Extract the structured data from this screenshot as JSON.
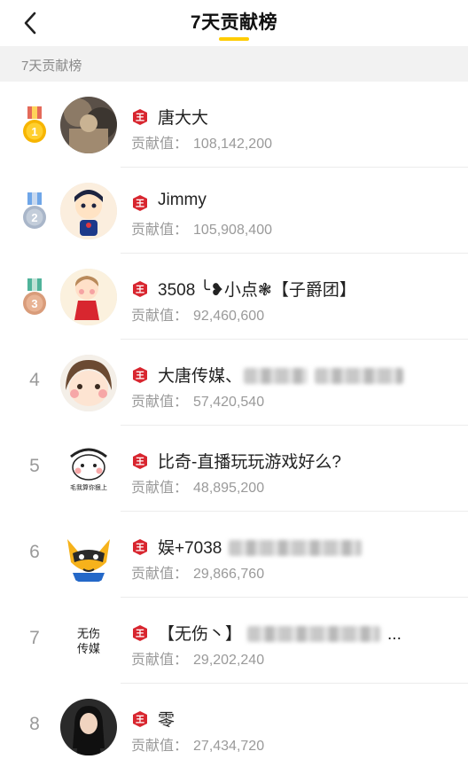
{
  "header": {
    "title": "7天贡献榜"
  },
  "section": {
    "label": "7天贡献榜"
  },
  "contrib_label": "贡献值：",
  "colors": {
    "accent": "#ffcc00",
    "badge": "#d8262f",
    "gold": "#f7b500",
    "silver": "#a9b6c9",
    "bronze": "#d99c7a"
  },
  "rows": [
    {
      "rank": "1",
      "name": "唐大大",
      "value": "108,142,200"
    },
    {
      "rank": "2",
      "name": "Jimmy",
      "value": "105,908,400"
    },
    {
      "rank": "3",
      "name": "3508 ╰❥小点❃【子爵团】",
      "value": "92,460,600"
    },
    {
      "rank": "4",
      "name": "大唐传媒、",
      "value": "57,420,540"
    },
    {
      "rank": "5",
      "name": "比奇-直播玩玩游戏好么?",
      "value": "48,895,200"
    },
    {
      "rank": "6",
      "name": "娱+7038",
      "value": "29,866,760"
    },
    {
      "rank": "7",
      "name": "【无伤丶】",
      "name_suffix": "...",
      "value": "29,202,240"
    },
    {
      "rank": "8",
      "name": "零",
      "value": "27,434,720"
    }
  ],
  "avatar_text": {
    "r5": "毛我算你狠上",
    "r7_line1": "无伤",
    "r7_line2": "传媒"
  }
}
